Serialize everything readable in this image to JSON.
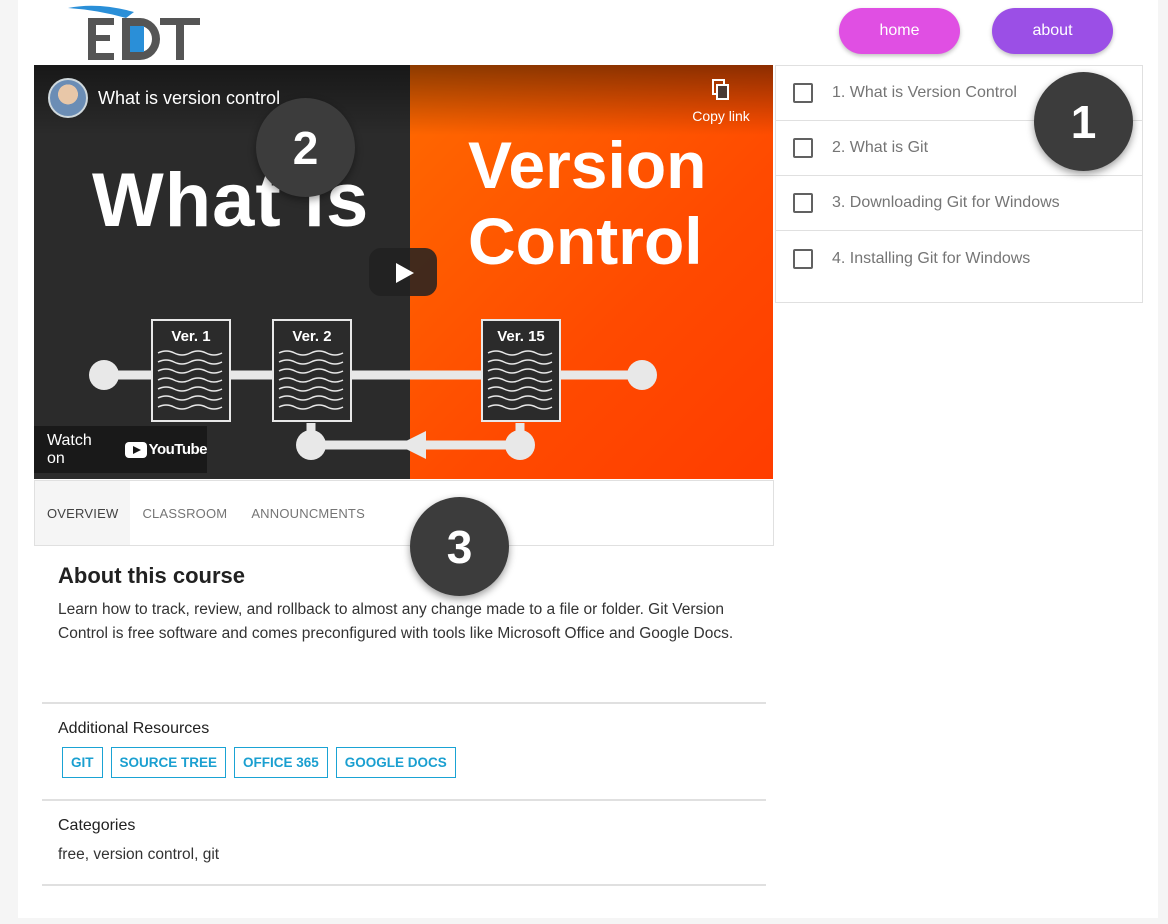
{
  "header": {
    "logo_text": "EDT",
    "nav": [
      {
        "label": "home",
        "color": "#e04fe3"
      },
      {
        "label": "about",
        "color": "#9b4fe6"
      }
    ]
  },
  "video": {
    "title": "What is version control",
    "copy_link": "Copy link",
    "thumb_line1": "What is",
    "thumb_line2": "Version",
    "thumb_line3": "Control",
    "versions": [
      "Ver. 1",
      "Ver. 2",
      "Ver. 15"
    ],
    "watch_on": "Watch on",
    "youtube": "YouTube"
  },
  "tabs": [
    {
      "label": "OVERVIEW",
      "active": true
    },
    {
      "label": "CLASSROOM",
      "active": false
    },
    {
      "label": "ANNOUNCMENTS",
      "active": false
    }
  ],
  "course": {
    "about_title": "About this course",
    "about_text": "Learn how to track, review, and rollback to almost any change made to a file or folder. Git Version Control is free software and comes preconfigured with tools like Microsoft Office and Google Docs.",
    "resources_label": "Additional Resources",
    "resources": [
      "GIT",
      "SOURCE TREE",
      "OFFICE 365",
      "GOOGLE DOCS"
    ],
    "categories_label": "Categories",
    "categories_value": "free, version control, git"
  },
  "lessons": [
    {
      "label": "1. What is Version Control",
      "checked": false
    },
    {
      "label": "2. What is Git",
      "checked": false
    },
    {
      "label": "3. Downloading Git for Windows",
      "checked": false
    },
    {
      "label": "4. Installing Git for Windows",
      "checked": false
    }
  ],
  "markers": [
    "1",
    "2",
    "3"
  ]
}
